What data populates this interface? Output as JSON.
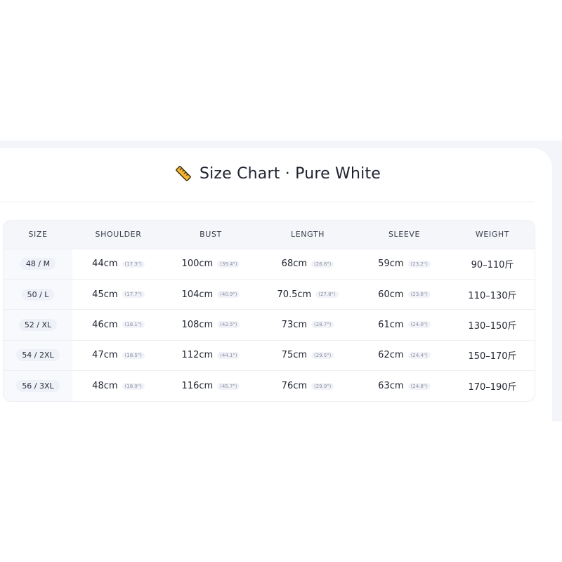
{
  "card": {
    "icon": "ruler-icon",
    "title": "Size Chart · Pure White"
  },
  "colors": {
    "icon_fill": "#f2b630",
    "icon_stroke": "#3a2a10",
    "header_bg": "#f4f6fa",
    "backdrop": "#f3f5fa"
  },
  "table": {
    "headers": [
      "SIZE",
      "SHOULDER",
      "BUST",
      "LENGTH",
      "SLEEVE",
      "WEIGHT"
    ],
    "rows": [
      {
        "size": "48 / M",
        "shoulder": "44cm",
        "shoulder_in": "(17.3\")",
        "bust": "100cm",
        "bust_in": "(39.4\")",
        "length": "68cm",
        "length_in": "(26.8\")",
        "sleeve": "59cm",
        "sleeve_in": "(23.2\")",
        "weight": "90–110斤"
      },
      {
        "size": "50 / L",
        "shoulder": "45cm",
        "shoulder_in": "(17.7\")",
        "bust": "104cm",
        "bust_in": "(40.9\")",
        "length": "70.5cm",
        "length_in": "(27.8\")",
        "sleeve": "60cm",
        "sleeve_in": "(23.6\")",
        "weight": "110–130斤"
      },
      {
        "size": "52 / XL",
        "shoulder": "46cm",
        "shoulder_in": "(18.1\")",
        "bust": "108cm",
        "bust_in": "(42.5\")",
        "length": "73cm",
        "length_in": "(28.7\")",
        "sleeve": "61cm",
        "sleeve_in": "(24.0\")",
        "weight": "130–150斤"
      },
      {
        "size": "54 / 2XL",
        "shoulder": "47cm",
        "shoulder_in": "(18.5\")",
        "bust": "112cm",
        "bust_in": "(44.1\")",
        "length": "75cm",
        "length_in": "(29.5\")",
        "sleeve": "62cm",
        "sleeve_in": "(24.4\")",
        "weight": "150–170斤"
      },
      {
        "size": "56 / 3XL",
        "shoulder": "48cm",
        "shoulder_in": "(18.9\")",
        "bust": "116cm",
        "bust_in": "(45.7\")",
        "length": "76cm",
        "length_in": "(29.9\")",
        "sleeve": "63cm",
        "sleeve_in": "(24.8\")",
        "weight": "170–190斤"
      }
    ]
  }
}
